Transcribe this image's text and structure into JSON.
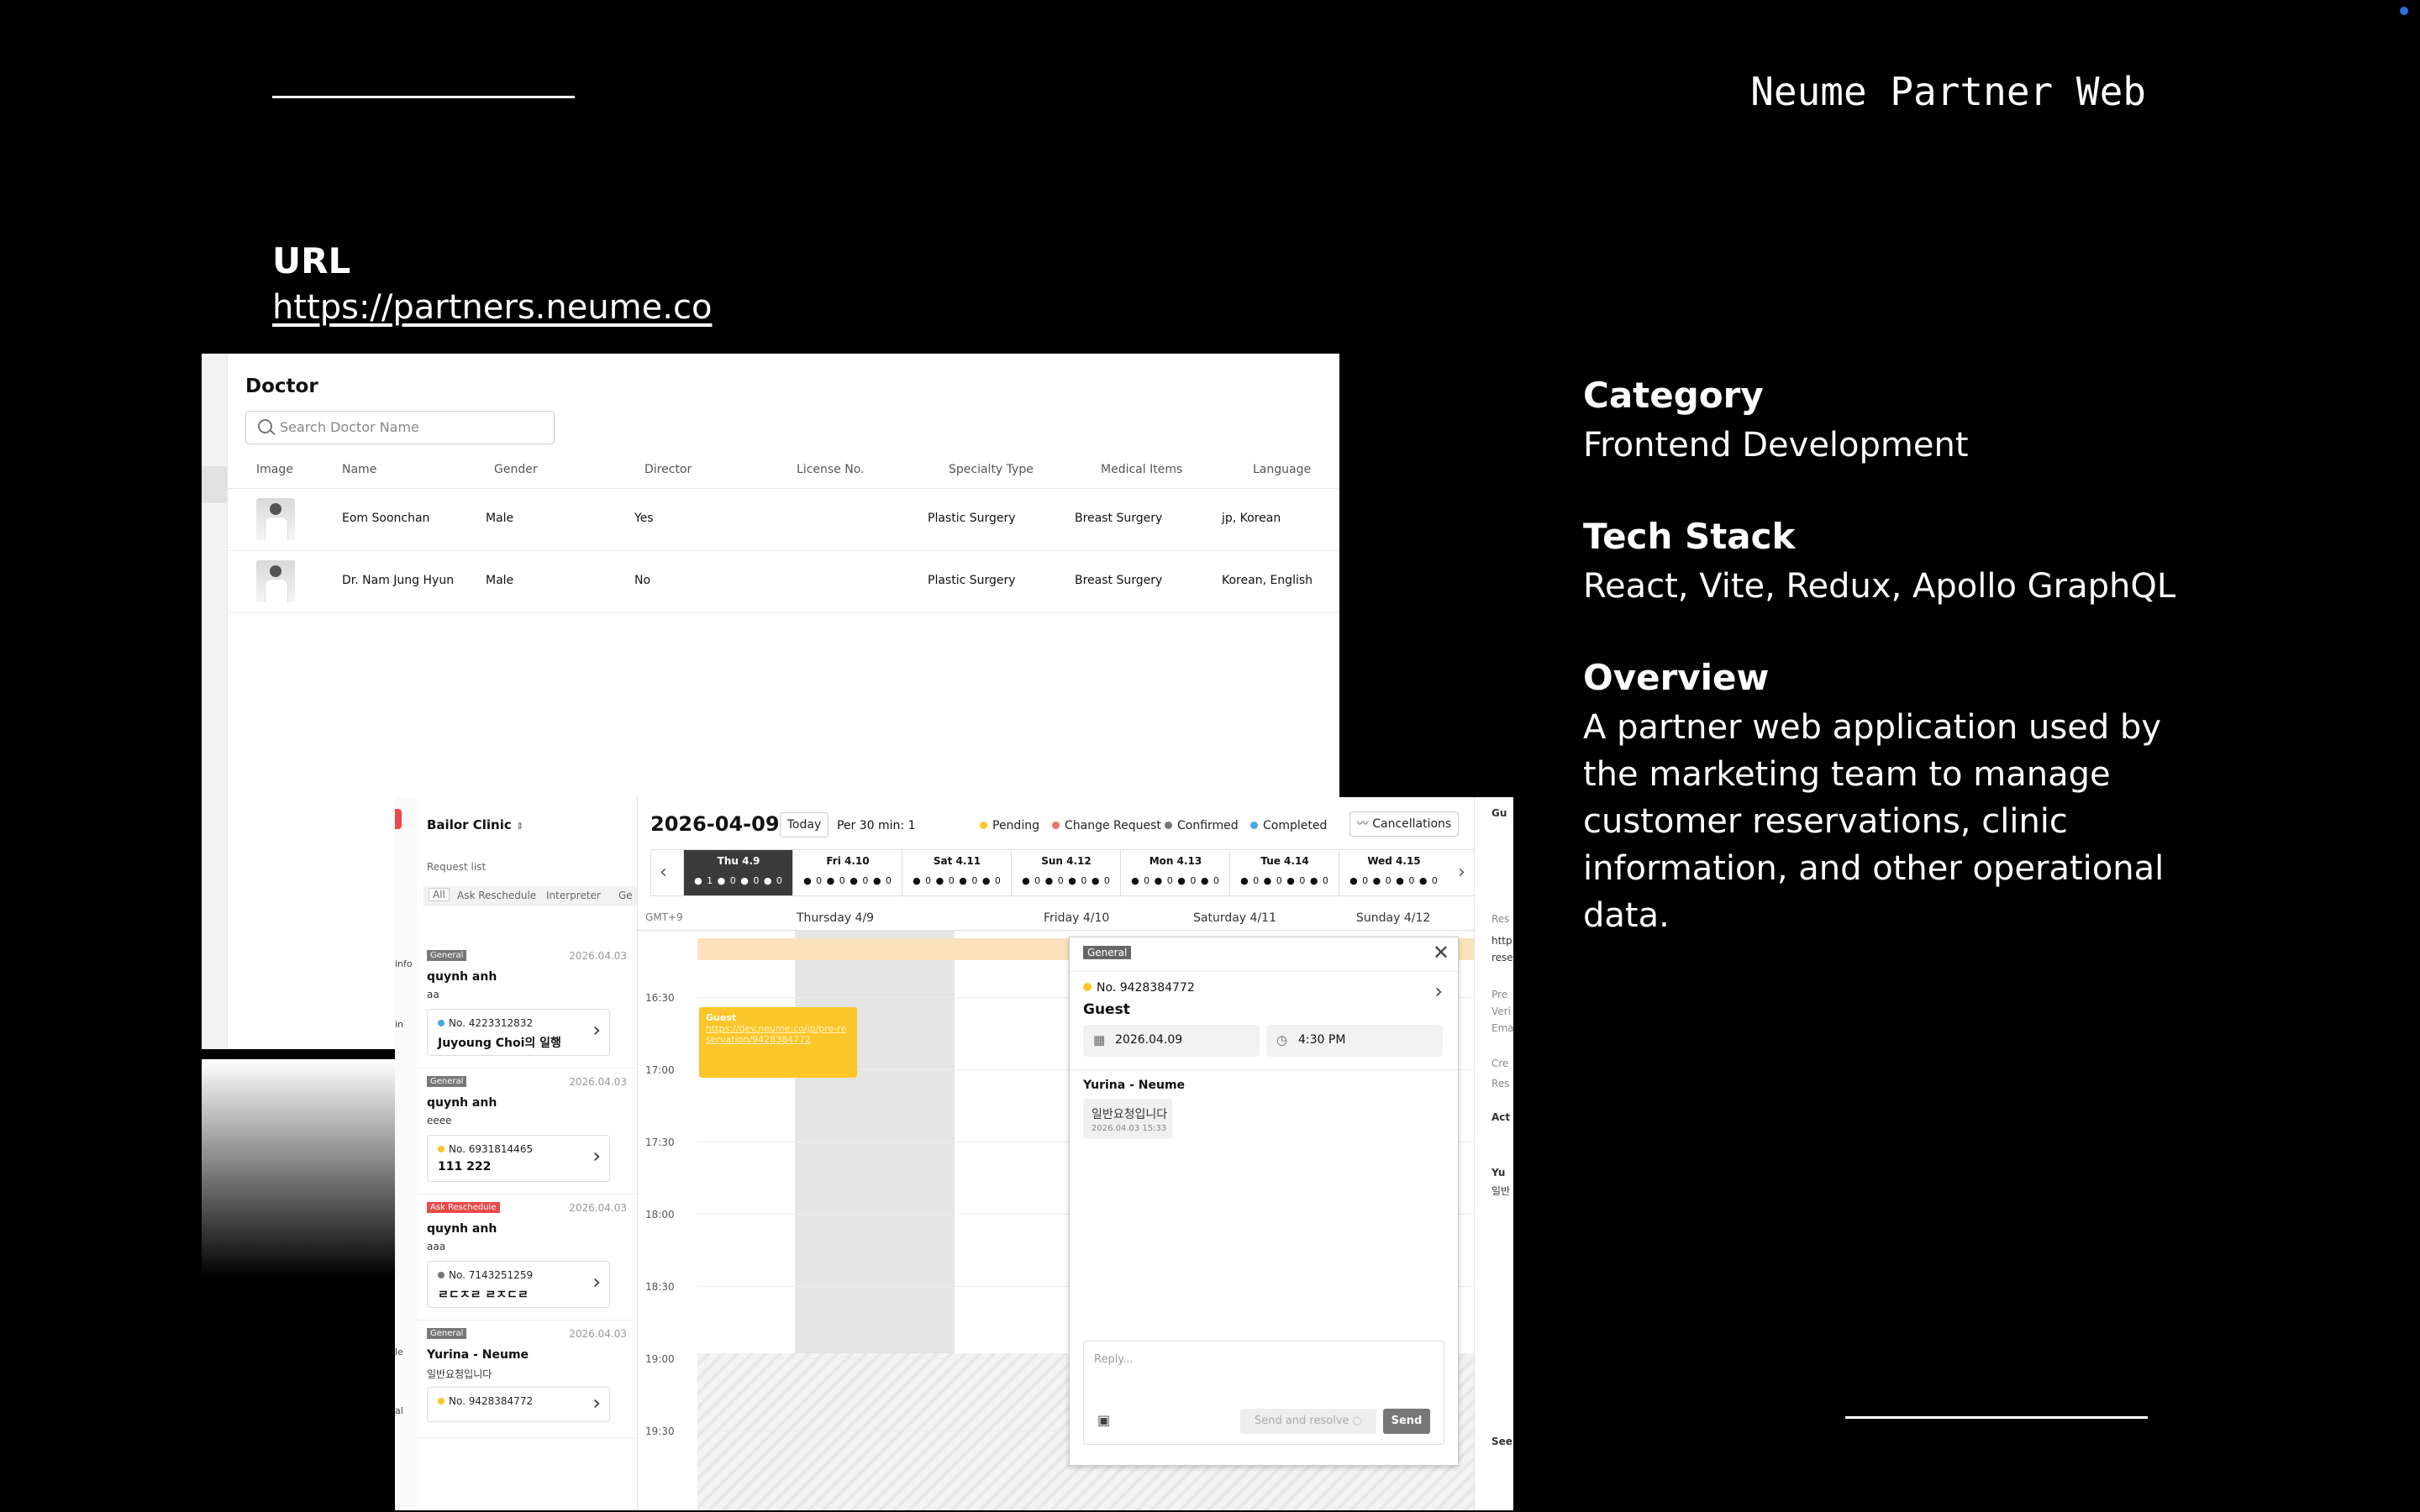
{
  "header": {
    "brand_title": "Neume Partner Web"
  },
  "url_section": {
    "label": "URL",
    "link": "https://partners.neume.co"
  },
  "info": {
    "category_label": "Category",
    "category_value": "Frontend Development",
    "tech_label": "Tech Stack",
    "tech_value": "React, Vite, Redux, Apollo GraphQL",
    "overview_label": "Overview",
    "overview_lines": [
      "A partner web application used by",
      "the marketing team to manage",
      "customer reservations, clinic",
      "information, and other operational",
      "data."
    ]
  },
  "doctor_screen": {
    "title": "Doctor",
    "search_placeholder": "Search Doctor Name",
    "columns": [
      "Image",
      "Name",
      "Gender",
      "Director",
      "License No.",
      "Specialty Type",
      "Medical Items",
      "Language"
    ],
    "rows": [
      {
        "name": "Eom Soonchan",
        "gender": "Male",
        "director": "Yes",
        "license": "",
        "specialty": "Plastic Surgery",
        "items": "Breast Surgery",
        "language": "jp, Korean"
      },
      {
        "name": "Dr. Nam Jung Hyun",
        "gender": "Male",
        "director": "No",
        "license": "",
        "specialty": "Plastic Surgery",
        "items": "Breast Surgery",
        "language": "Korean, English"
      }
    ]
  },
  "calendar_screen": {
    "clinic_name": "Bailor Clinic",
    "request_list_label": "Request list",
    "filters": [
      "All",
      "Ask Reschedule",
      "Interpreter",
      "Ge"
    ],
    "sidebar_fragments": [
      "info",
      "in",
      "le",
      "al"
    ],
    "requests": [
      {
        "tag": "General",
        "tag_color": "#777777",
        "date": "2026.04.03",
        "name": "quynh anh",
        "message": "aa",
        "no": "No. 4223312832",
        "dot": "#4aa8e0",
        "title": "Juyoung Choi의 일행"
      },
      {
        "tag": "General",
        "tag_color": "#777777",
        "date": "2026.04.03",
        "name": "quynh anh",
        "message": "eeee",
        "no": "No. 6931814465",
        "dot": "#fcc62a",
        "title": "111 222"
      },
      {
        "tag": "Ask Reschedule",
        "tag_color": "#e84a4a",
        "date": "2026.04.03",
        "name": "quynh anh",
        "message": "aaa",
        "no": "No. 7143251259",
        "dot": "#777777",
        "title": "ㄹㄷㅈㄹ ㄹㅈㄷㄹ"
      },
      {
        "tag": "General",
        "tag_color": "#777777",
        "date": "2026.04.03",
        "name": "Yurina - Neume",
        "message": "일반요청입니다",
        "no": "No. 9428384772",
        "dot": "#fcc62a",
        "title": ""
      }
    ],
    "current_date": "2026-04-09",
    "today_label": "Today",
    "per_slot": "Per 30 min: 1",
    "legend": [
      {
        "label": "Pending",
        "color": "#fcc62a"
      },
      {
        "label": "Change Request",
        "color": "#f07070"
      },
      {
        "label": "Confirmed",
        "color": "#777777"
      },
      {
        "label": "Completed",
        "color": "#4aa8e0"
      }
    ],
    "cancellations_label": "Cancellations",
    "week_days": [
      {
        "label": "Thu 4.9",
        "counts": "● 1 ● 0 ● 0 ● 0"
      },
      {
        "label": "Fri 4.10",
        "counts": "● 0 ● 0 ● 0 ● 0"
      },
      {
        "label": "Sat 4.11",
        "counts": "● 0 ● 0 ● 0 ● 0"
      },
      {
        "label": "Sun 4.12",
        "counts": "● 0 ● 0 ● 0 ● 0"
      },
      {
        "label": "Mon 4.13",
        "counts": "● 0 ● 0 ● 0 ● 0"
      },
      {
        "label": "Tue 4.14",
        "counts": "● 0 ● 0 ● 0 ● 0"
      },
      {
        "label": "Wed 4.15",
        "counts": "● 0 ● 0 ● 0 ● 0"
      }
    ],
    "timezone": "GMT+9",
    "grid_days": [
      "Thursday 4/9",
      "Friday 4/10",
      "Saturday 4/11",
      "Sunday 4/12"
    ],
    "times": [
      "16:30",
      "17:00",
      "17:30",
      "18:00",
      "18:30",
      "19:00",
      "19:30"
    ],
    "event": {
      "title": "Guest",
      "link": "https://dev.neume.co/jp/pre-reservation/9428384772"
    },
    "popup": {
      "tag": "General",
      "no": "No. 9428384772",
      "guest": "Guest",
      "date": "2026.04.09",
      "time": "4:30 PM",
      "author": "Yurina - Neume",
      "message": "일반요청입니다",
      "message_time": "2026.04.03 15:33",
      "reply_placeholder": "Reply...",
      "send_resolve_label": "Send and resolve",
      "send_label": "Send"
    },
    "right_fragments": [
      "Gu",
      "Res",
      "http",
      "rese",
      "Pre",
      "Veri",
      "Ema",
      "Cre",
      "Res",
      "Act",
      "Yu",
      "일반",
      "See"
    ]
  }
}
